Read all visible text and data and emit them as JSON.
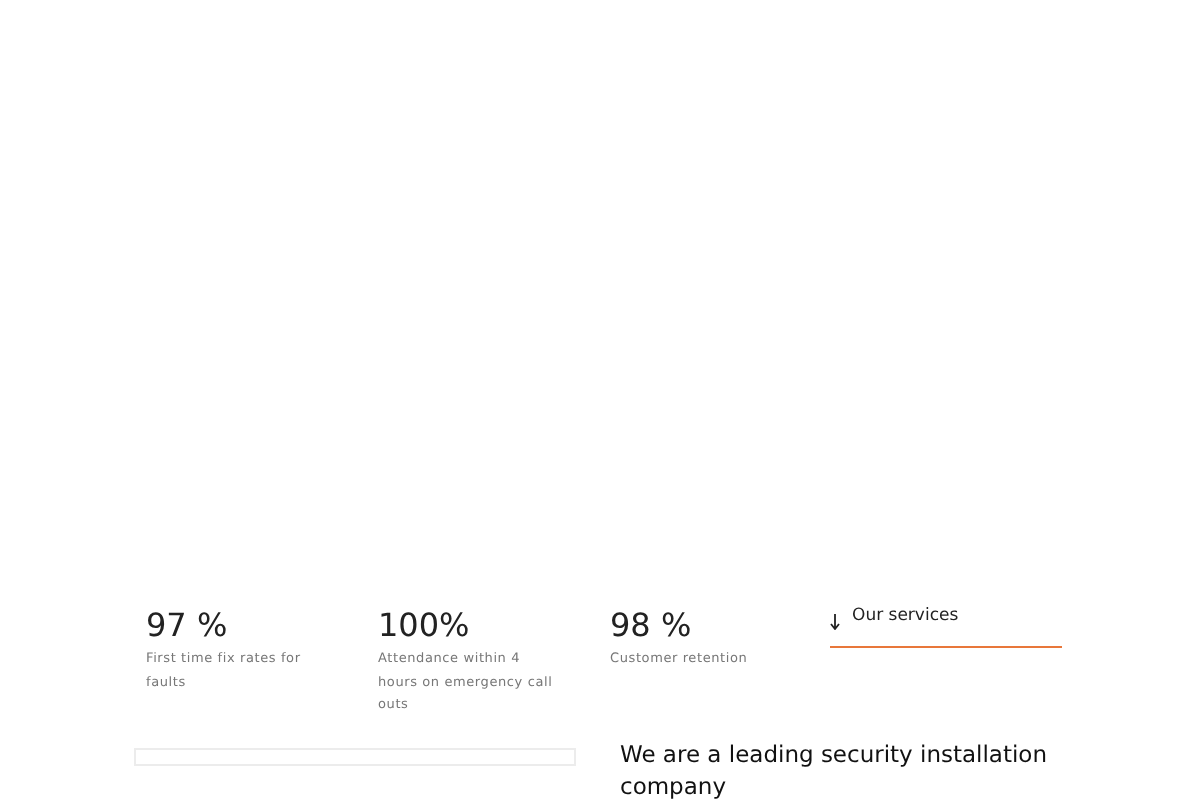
{
  "stats": [
    {
      "value": "97 %",
      "caption": "First time fix rates for faults"
    },
    {
      "value": "100%",
      "caption": "Attendance within 4 hours on emergency call outs"
    },
    {
      "value": "98 %",
      "caption": "Customer retention"
    }
  ],
  "services_link": {
    "label": "Our services"
  },
  "heading": "We are a leading security installation company"
}
